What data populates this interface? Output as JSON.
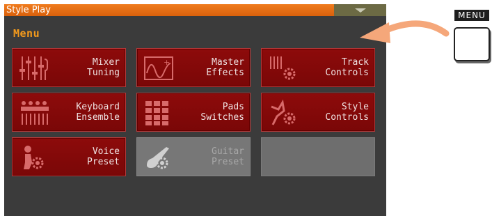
{
  "titlebar": {
    "title": "Style Play",
    "dropdown_icon": "chevron-down-icon"
  },
  "menu": {
    "heading": "Menu",
    "tiles": [
      {
        "line1": "Mixer",
        "line2": "Tuning",
        "icon": "mixer-sliders-icon",
        "enabled": true
      },
      {
        "line1": "Master",
        "line2": "Effects",
        "icon": "fx-waveform-icon",
        "enabled": true
      },
      {
        "line1": "Track",
        "line2": "Controls",
        "icon": "track-controls-icon",
        "enabled": true
      },
      {
        "line1": "Keyboard",
        "line2": "Ensemble",
        "icon": "keyboard-ensemble-icon",
        "enabled": true
      },
      {
        "line1": "Pads",
        "line2": "Switches",
        "icon": "pads-grid-icon",
        "enabled": true
      },
      {
        "line1": "Style",
        "line2": "Controls",
        "icon": "style-controls-icon",
        "enabled": true
      },
      {
        "line1": "Voice",
        "line2": "Preset",
        "icon": "voice-preset-icon",
        "enabled": true
      },
      {
        "line1": "Guitar",
        "line2": "Preset",
        "icon": "guitar-preset-icon",
        "enabled": false
      }
    ]
  },
  "hardware": {
    "menu_button_label": "MENU"
  },
  "colors": {
    "titlebar": "#e8701a",
    "heading": "#f39a1c",
    "tile": "#850909",
    "arrow": "#f5a77a"
  }
}
